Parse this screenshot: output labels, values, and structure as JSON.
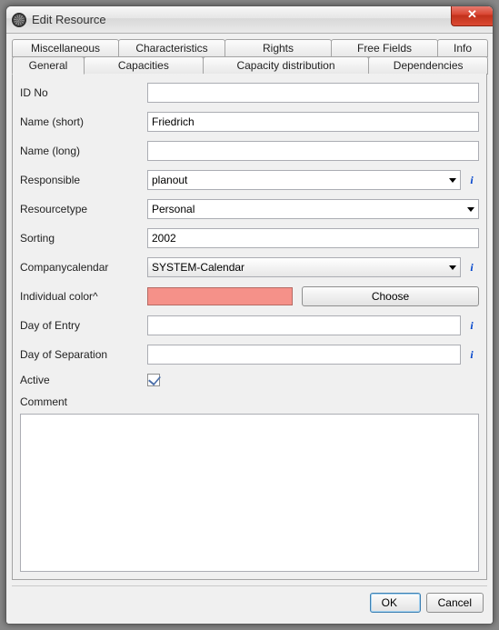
{
  "window": {
    "title": "Edit Resource"
  },
  "tabs": {
    "row1": [
      "Miscellaneous",
      "Characteristics",
      "Rights",
      "Free Fields",
      "Info"
    ],
    "row2": [
      "General",
      "Capacities",
      "Capacity distribution",
      "Dependencies"
    ],
    "active": "General"
  },
  "form": {
    "id_no": {
      "label": "ID No",
      "value": ""
    },
    "name_short": {
      "label": "Name (short)",
      "value": "Friedrich"
    },
    "name_long": {
      "label": "Name (long)",
      "value": ""
    },
    "responsible": {
      "label": "Responsible",
      "value": "planout"
    },
    "resourcetype": {
      "label": "Resourcetype",
      "value": "Personal"
    },
    "sorting": {
      "label": "Sorting",
      "value": "2002"
    },
    "company_cal": {
      "label": "Companycalendar",
      "value": "SYSTEM-Calendar"
    },
    "indiv_color": {
      "label": "Individual color^",
      "swatch": "#f59189",
      "choose": "Choose"
    },
    "day_entry": {
      "label": "Day of Entry",
      "value": ""
    },
    "day_sep": {
      "label": "Day of Separation",
      "value": ""
    },
    "active": {
      "label": "Active",
      "checked": true
    },
    "comment": {
      "label": "Comment",
      "value": ""
    }
  },
  "buttons": {
    "ok": "OK",
    "cancel": "Cancel"
  }
}
